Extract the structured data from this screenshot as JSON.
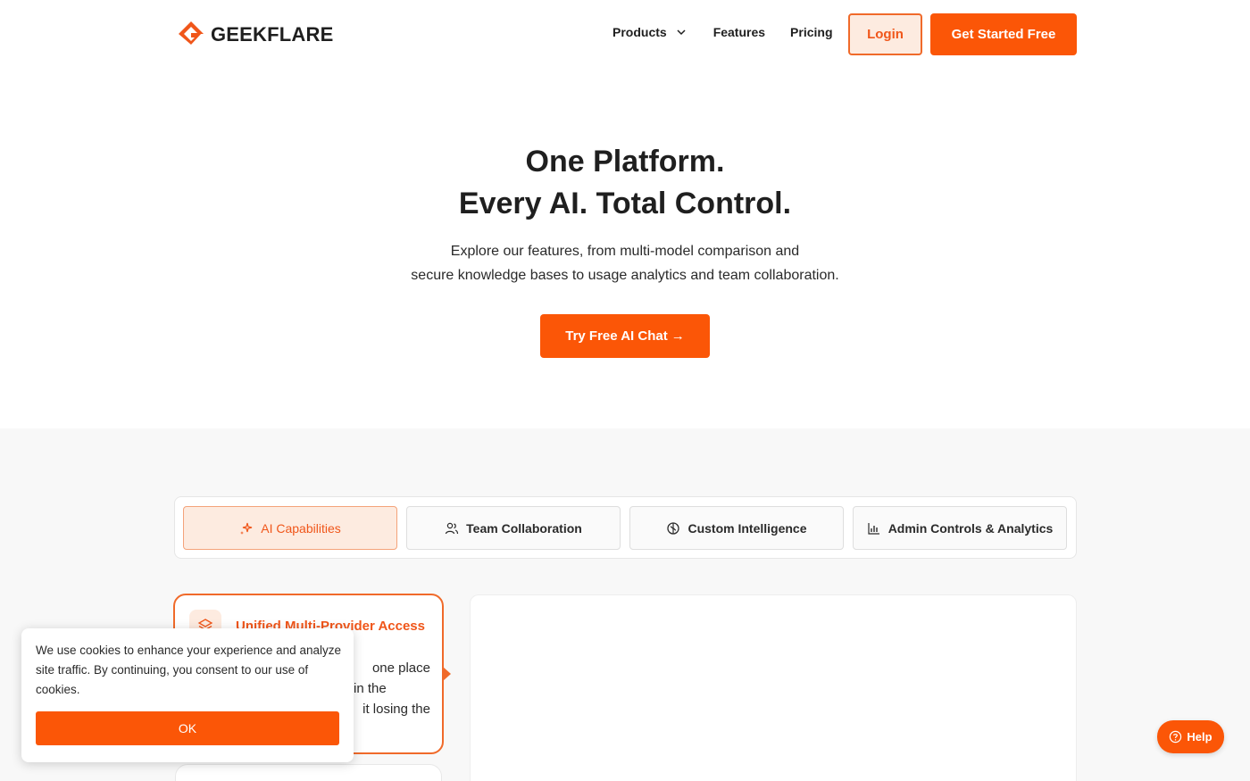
{
  "header": {
    "logo_text": "GEEKFLARE",
    "nav": {
      "products": "Products",
      "features": "Features",
      "pricing": "Pricing"
    },
    "login_label": "Login",
    "get_started_label": "Get Started Free"
  },
  "hero": {
    "title_line1": "One Platform.",
    "title_line2": "Every AI. Total Control.",
    "subtitle_line1": "Explore our features, from multi-model comparison and",
    "subtitle_line2": "secure knowledge bases to usage analytics and team collaboration.",
    "cta_label": "Try Free AI Chat",
    "cta_arrow": "→"
  },
  "tabs": [
    {
      "label": "AI Capabilities",
      "icon": "sparkle-icon",
      "active": true
    },
    {
      "label": "Team Collaboration",
      "icon": "users-icon",
      "active": false
    },
    {
      "label": "Custom Intelligence",
      "icon": "brain-icon",
      "active": false
    },
    {
      "label": "Admin Controls & Analytics",
      "icon": "bar-chart-icon",
      "active": false
    }
  ],
  "feature_card": {
    "title": "Unified Multi-Provider Access",
    "desc_line1": "one place",
    "desc_line2": "in the",
    "desc_line3": "it losing the"
  },
  "cookie": {
    "text": "We use cookies to enhance your experience and analyze site traffic. By continuing, you consent to our use of cookies.",
    "ok_label": "OK"
  },
  "help": {
    "label": "Help"
  },
  "colors": {
    "brand": "#fb5607",
    "brand_light": "#fdebe0",
    "text": "#1f1f1f",
    "band_bg": "#f8f8f8"
  }
}
